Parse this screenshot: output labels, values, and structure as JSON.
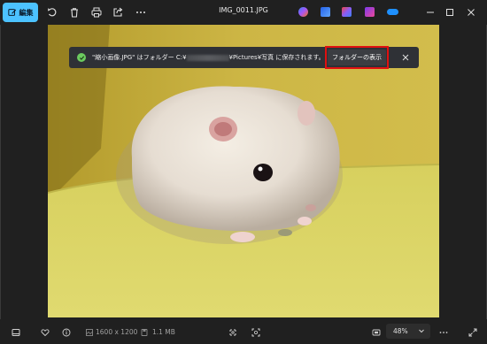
{
  "toolbar": {
    "edit_label": "編集",
    "filename": "IMG_0011.JPG"
  },
  "notification": {
    "message_prefix": "\"縮小画像.JPG\" はフォルダー C:¥",
    "message_suffix": "¥Pictures¥写真 に保存されます。",
    "action_label": "フォルダーの表示"
  },
  "statusbar": {
    "dimensions": "1600 x 1200",
    "file_size": "1.1 MB",
    "zoom": "48%"
  },
  "colors": {
    "accent": "#4cc2ff",
    "highlight_box": "#e01010",
    "success": "#6ccb5f"
  },
  "icons": {
    "toolbar": [
      "edit-icon",
      "rotate-icon",
      "delete-icon",
      "print-icon",
      "share-icon",
      "more-icon"
    ],
    "apps": [
      "copilot-icon",
      "designer-icon",
      "paint-icon",
      "clipchamp-icon",
      "onedrive-icon"
    ],
    "window": [
      "minimize-icon",
      "maximize-icon",
      "close-icon"
    ],
    "bottom": [
      "filmstrip-icon",
      "favorite-icon",
      "info-icon",
      "image-size-icon",
      "file-size-icon",
      "crop-icon",
      "select-icon",
      "fit-icon",
      "more-icon",
      "fullscreen-icon"
    ]
  }
}
